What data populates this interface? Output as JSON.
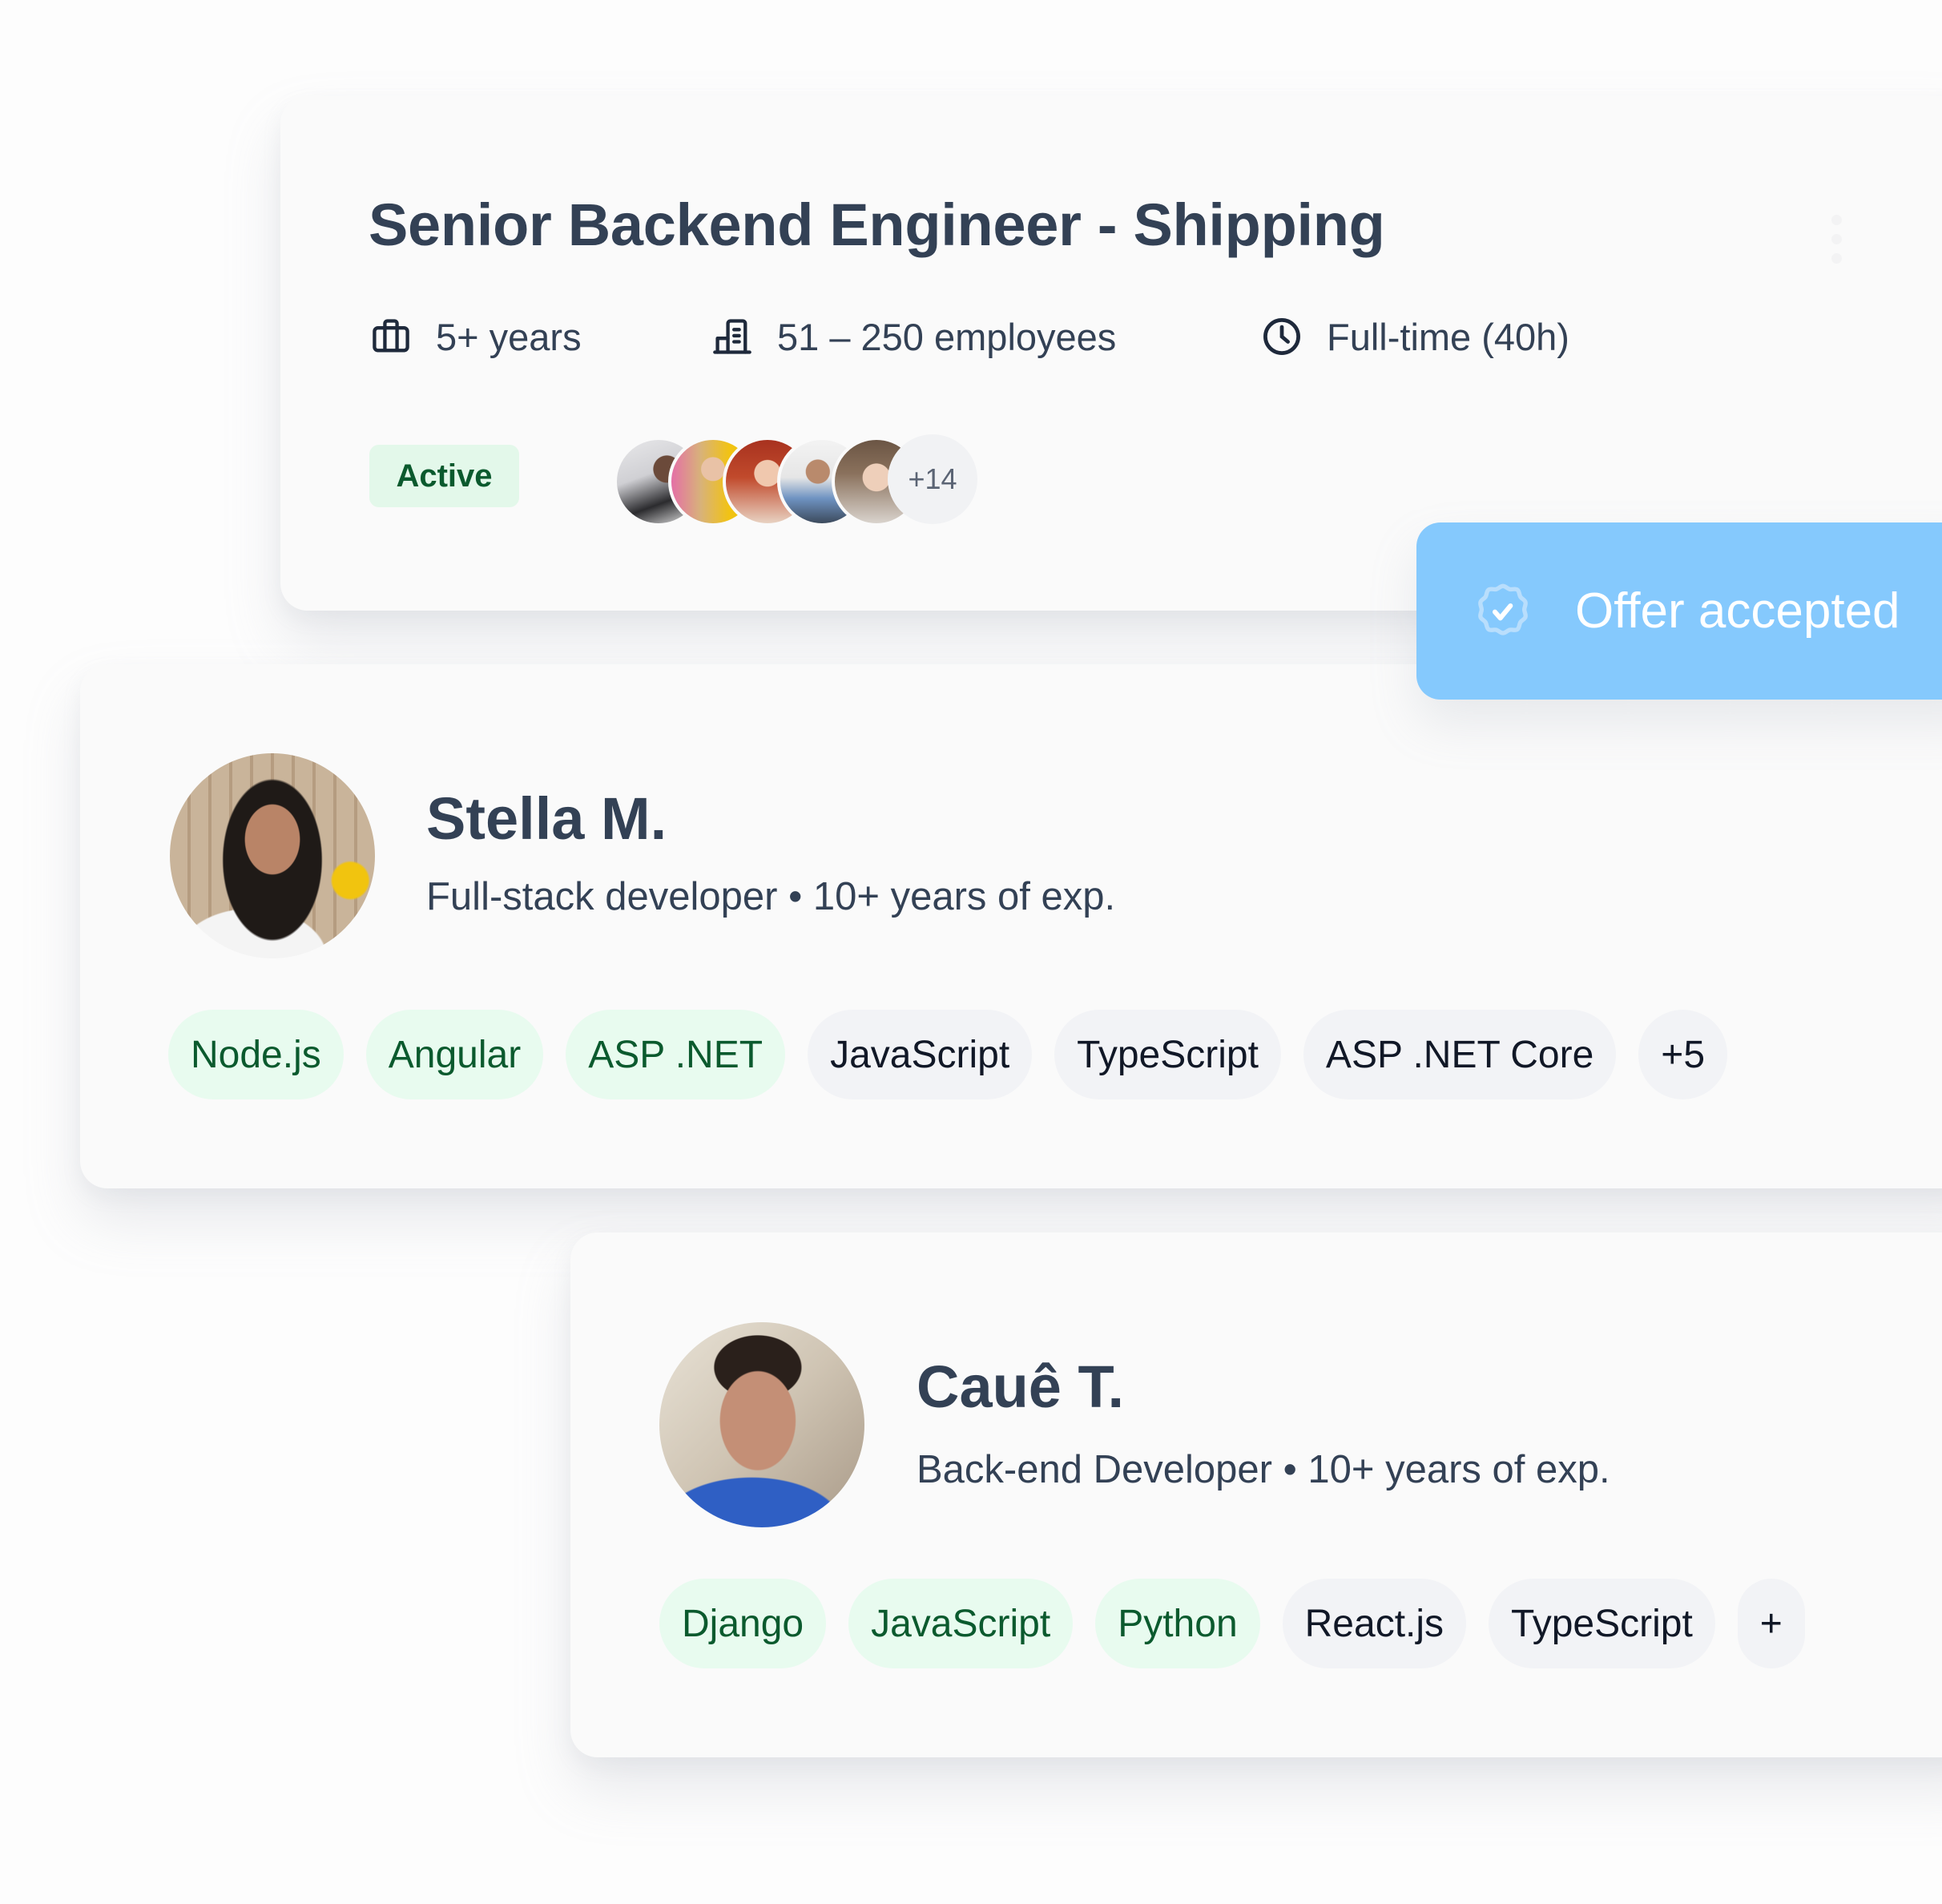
{
  "job": {
    "title": "Senior Backend Engineer - Shipping",
    "meta": [
      {
        "icon": "briefcase-icon",
        "label": "5+ years"
      },
      {
        "icon": "building-icon",
        "label": "51 – 250 employees"
      },
      {
        "icon": "clock-icon",
        "label": "Full-time (40h)"
      }
    ],
    "status": "Active",
    "applicant_more_count": "+14",
    "more_menu_icon": "kebab-vertical-icon"
  },
  "offer_badge": {
    "icon": "verified-badge-check-icon",
    "label": "Offer accepted"
  },
  "candidates": [
    {
      "name": "Stella M.",
      "subtitle": "Full-stack developer • 10+ years of exp.",
      "tags": [
        {
          "label": "Node.js",
          "match": true
        },
        {
          "label": "Angular",
          "match": true
        },
        {
          "label": "ASP .NET",
          "match": true
        },
        {
          "label": "JavaScript",
          "match": false
        },
        {
          "label": "TypeScript",
          "match": false
        },
        {
          "label": "ASP .NET Core",
          "match": false
        },
        {
          "label": "+5",
          "match": false
        }
      ]
    },
    {
      "name": "Cauê T.",
      "subtitle": "Back-end Developer • 10+ years of exp.",
      "tags": [
        {
          "label": "Django",
          "match": true
        },
        {
          "label": "JavaScript",
          "match": true
        },
        {
          "label": "Python",
          "match": true
        },
        {
          "label": "React.js",
          "match": false
        },
        {
          "label": "TypeScript",
          "match": false
        },
        {
          "label": "+",
          "match": false
        }
      ]
    }
  ],
  "colors": {
    "text": "#334155",
    "match_tag_bg": "#e8fbef",
    "match_tag_text": "#0b5a2e",
    "other_tag_bg": "#f2f3f6",
    "other_tag_text": "#111827",
    "active_badge_bg": "#e3f8ea",
    "offer_badge_bg": "#85c9fd"
  }
}
